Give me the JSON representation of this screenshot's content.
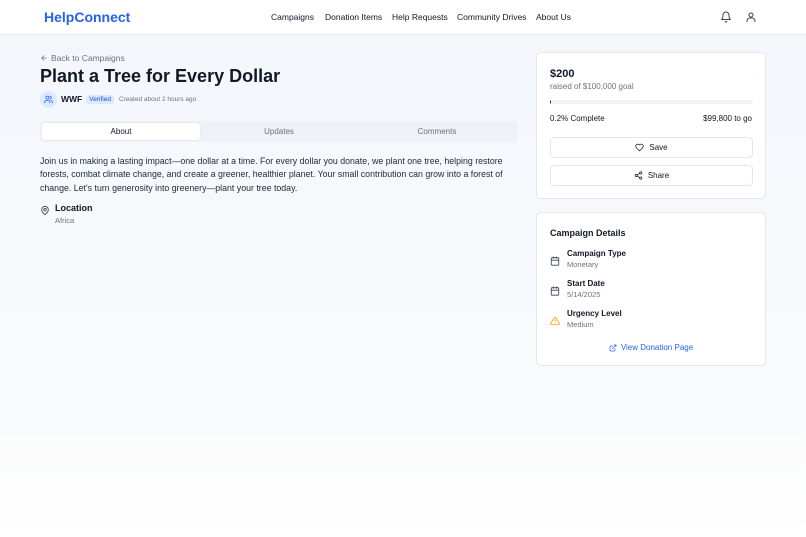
{
  "header": {
    "brand": "HelpConnect",
    "nav": [
      "Campaigns",
      "Donation Items",
      "Help Requests",
      "Community Drives",
      "About Us"
    ],
    "icons": [
      "bell-icon",
      "user-icon"
    ]
  },
  "campaign": {
    "back_label": "Back to Campaigns",
    "title": "Plant a Tree for Every Dollar",
    "org": {
      "name": "WWF",
      "verified": "Verified",
      "created": "Created about 2 hours ago"
    },
    "tabs": [
      {
        "label": "About",
        "active": true
      },
      {
        "label": "Updates",
        "active": false
      },
      {
        "label": "Comments",
        "active": false
      }
    ],
    "description": "Join us in making a lasting impact—one dollar at a time. For every dollar you donate, we plant one tree, helping restore forests, combat climate change, and create a greener, healthier planet. Your small contribution can grow into a forest of change. Let's turn generosity into greenery—plant your tree today.",
    "location": {
      "label": "Location",
      "value": "Africa"
    }
  },
  "funding": {
    "raised": "$200",
    "goal_text": "raised of $100,000 goal",
    "progress_fraction": 0.002,
    "percent_label": "0.2% Complete",
    "remaining_label": "$99,800 to go",
    "save_label": "Save",
    "share_label": "Share"
  },
  "details": {
    "title": "Campaign Details",
    "items": [
      {
        "label": "Campaign Type",
        "value": "Monetary",
        "icon": "calendar-icon"
      },
      {
        "label": "Start Date",
        "value": "5/14/2025",
        "icon": "calendar-icon"
      },
      {
        "label": "Urgency Level",
        "value": "Medium",
        "icon": "warning-icon"
      }
    ],
    "view_link": "View Donation Page"
  },
  "colors": {
    "brand": "#2563eb",
    "warning": "#f59e0b",
    "badge_bg": "#dbeafe"
  }
}
